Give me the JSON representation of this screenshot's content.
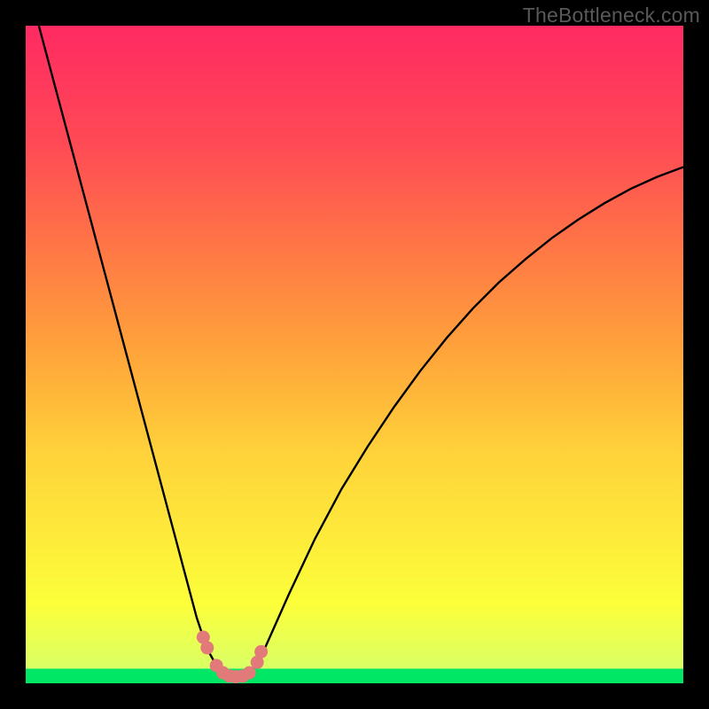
{
  "attribution": "TheBottleneck.com",
  "colors": {
    "frame": "#000000",
    "gradient_top": "#ff2a63",
    "gradient_bottom": "#00e765",
    "curve_stroke": "#000000",
    "marker_fill": "#e27a7a"
  },
  "chart_data": {
    "type": "line",
    "title": "",
    "xlabel": "",
    "ylabel": "",
    "xlim": [
      0,
      100
    ],
    "ylim": [
      0,
      100
    ],
    "x": [
      0,
      2,
      4,
      6,
      8,
      10,
      12,
      14,
      16,
      18,
      20,
      22,
      24,
      26,
      27,
      28,
      29,
      30,
      31,
      32,
      33,
      34,
      35,
      36,
      38,
      40,
      44,
      48,
      52,
      56,
      60,
      64,
      68,
      72,
      76,
      80,
      84,
      88,
      92,
      96,
      100
    ],
    "values": [
      108,
      100,
      92.5,
      85,
      77.5,
      70,
      62.5,
      55,
      47.5,
      40,
      32.5,
      25,
      17.5,
      10,
      7,
      4.5,
      2.7,
      1.6,
      1.1,
      1.0,
      1.1,
      1.6,
      2.7,
      4.5,
      9,
      13.5,
      22,
      29.5,
      36,
      42,
      47.5,
      52.5,
      57,
      61,
      64.5,
      67.7,
      70.5,
      73,
      75.2,
      77,
      78.5
    ],
    "markers": {
      "x": [
        27.0,
        27.6,
        29.0,
        30.0,
        31.0,
        32.0,
        33.0,
        34.0,
        35.2,
        35.8
      ],
      "y": [
        7.0,
        5.4,
        2.7,
        1.6,
        1.1,
        1.0,
        1.1,
        1.6,
        3.2,
        4.8
      ]
    },
    "notes": "Y axis is inverted visually (0 at bottom of plot). Values estimated from pixel positions; no tick labels or grid present in source image."
  }
}
